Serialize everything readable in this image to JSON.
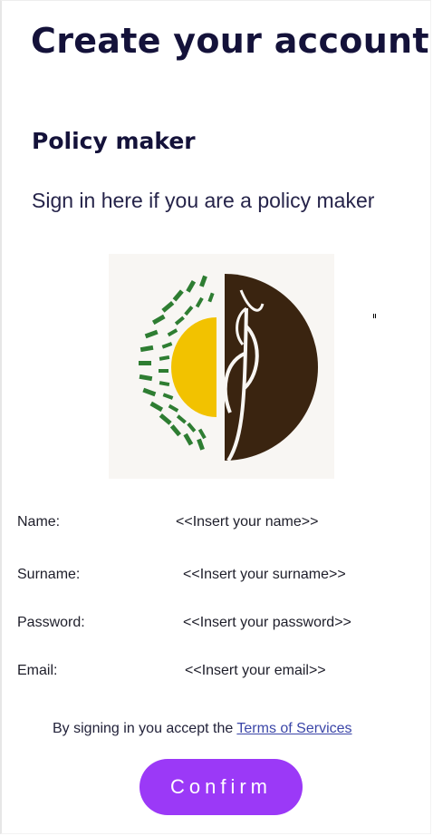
{
  "page": {
    "title": "Create your account",
    "role_heading": "Policy maker",
    "tagline": "Sign in here if you are a policy maker"
  },
  "logo": {
    "icon": "wheat-sun-emblem-icon",
    "colors": {
      "leaf_green": "#2e7d32",
      "sun_yellow": "#f2c200",
      "soil_brown": "#3a2410",
      "background": "#f8f6f3"
    }
  },
  "form": {
    "fields": [
      {
        "label": "Name:",
        "value": "<<Insert your name>>"
      },
      {
        "label": "Surname:",
        "value": "<<Insert your surname>>"
      },
      {
        "label": "Password:",
        "value": "<<Insert your password>>"
      },
      {
        "label": "Email:",
        "value": "<<Insert your email>>"
      }
    ]
  },
  "terms": {
    "prefix": "By signing in you accept the ",
    "link": "Terms of Services"
  },
  "confirm_label": "Confirm",
  "colors": {
    "heading": "#14123a",
    "link": "#3b46a8",
    "button": "#9b39f7"
  }
}
